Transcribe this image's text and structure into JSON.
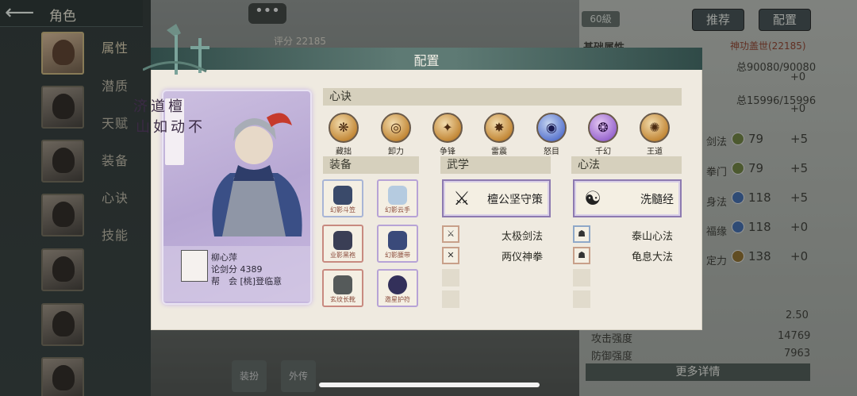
{
  "window": {
    "title": "角色",
    "back_icon": "back-arrow-icon",
    "menu_icon": "more-dots-icon",
    "menu_label": "•••"
  },
  "side_nav": [
    {
      "label": "属性",
      "active": true
    },
    {
      "label": "潜质"
    },
    {
      "label": "天赋"
    },
    {
      "label": "装备"
    },
    {
      "label": "心诀"
    },
    {
      "label": "技能"
    }
  ],
  "background": {
    "score_label": "评分 22185",
    "level": "60級",
    "recommend_button": "推荐",
    "config_button": "配置",
    "basic_attr_header": "基础属性",
    "shengong": "神功盖世(22185)",
    "total1": "总90080/90080",
    "plus1": "+0",
    "total2": "总15996/15996",
    "plus2": "+0",
    "stats": [
      {
        "label": "剑法",
        "value": "79",
        "bonus": "+5"
      },
      {
        "label": "拳门",
        "value": "79",
        "bonus": "+5"
      },
      {
        "label": "身法",
        "value": "118",
        "bonus": "+5"
      },
      {
        "label": "福缘",
        "value": "118",
        "bonus": "+0"
      },
      {
        "label": "定力",
        "value": "138",
        "bonus": "+0"
      }
    ],
    "v250": "2.50",
    "attack_label": "攻击强度",
    "attack_value": "14769",
    "defense_label": "防御强度",
    "defense_value": "7963",
    "more_details": "更多详情",
    "bottom_tab1": "装扮",
    "bottom_tab2": "外传"
  },
  "dialog": {
    "title": "配置",
    "character": {
      "name_vertical": [
        "檀",
        "道",
        "济"
      ],
      "slogan_vertical": [
        "不",
        "动",
        "如",
        "山"
      ],
      "player_name": "柳心萍",
      "sword_score": "论剑分 4389",
      "guild": "帮　会 [桃]登临意"
    },
    "xinjue": {
      "header": "心诀",
      "skills": [
        {
          "label": "藏拙",
          "style": "gold"
        },
        {
          "label": "卸力",
          "style": "gold"
        },
        {
          "label": "争锋",
          "style": "gold"
        },
        {
          "label": "雷震",
          "style": "gold"
        },
        {
          "label": "怒目",
          "style": "blue"
        },
        {
          "label": "千幻",
          "style": "purple"
        },
        {
          "label": "王道",
          "style": "gold"
        }
      ]
    },
    "equipment": {
      "header": "装备",
      "items": [
        {
          "label": "幻影斗笠",
          "border": "blue"
        },
        {
          "label": "幻影云手",
          "border": "purple"
        },
        {
          "label": "业影黑袍",
          "border": "red"
        },
        {
          "label": "幻影腰带",
          "border": "purple"
        },
        {
          "label": "玄纹长靴",
          "border": "red"
        },
        {
          "label": "邀星护符",
          "border": "purple"
        }
      ]
    },
    "wuxue": {
      "header": "武学",
      "main": "檀公坚守策",
      "list": [
        "太极剑法",
        "两仪神拳"
      ]
    },
    "xinfa": {
      "header": "心法",
      "main": "洗髓经",
      "list": [
        "泰山心法",
        "龟息大法"
      ]
    }
  }
}
